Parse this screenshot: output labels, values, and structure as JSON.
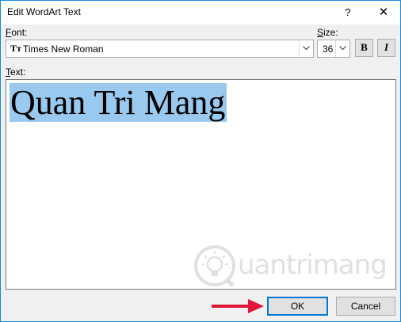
{
  "window": {
    "title": "Edit WordArt Text",
    "help_glyph": "?",
    "close_glyph": "✕"
  },
  "font": {
    "label_hotkey": "F",
    "label_rest": "ont:",
    "value": "Times New Roman",
    "glyph": "Tт",
    "icon": "truetype-font-icon"
  },
  "size": {
    "label_hotkey": "S",
    "label_rest": "ize:",
    "value": "36"
  },
  "format": {
    "bold_label": "B",
    "italic_label": "I"
  },
  "text": {
    "label_hotkey": "T",
    "label_rest": "ext:",
    "value": "Quan Tri Mang"
  },
  "watermark": {
    "text": "uantrimang"
  },
  "buttons": {
    "ok_label": "OK",
    "cancel_label": "Cancel"
  },
  "colors": {
    "accent": "#0078d7",
    "selection": "#99c9ef",
    "arrow": "#e0173a"
  }
}
